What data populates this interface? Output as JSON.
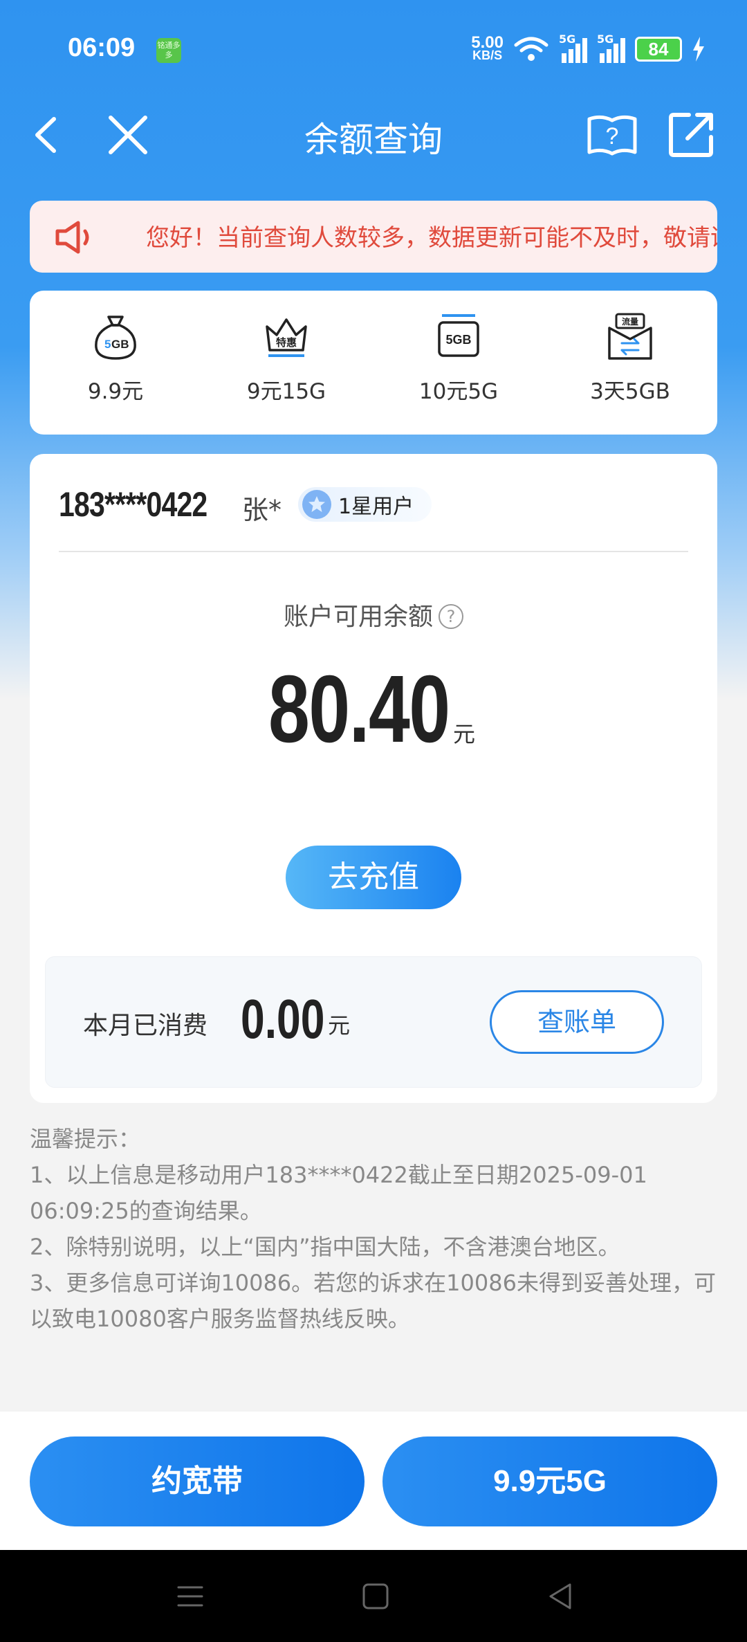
{
  "status_bar": {
    "time": "06:09",
    "app_icon_text": "铭通多多",
    "net_speed_value": "5.00",
    "net_speed_unit": "KB/S",
    "signal_1": "5G",
    "signal_2": "5G",
    "battery": "84"
  },
  "header": {
    "title": "余额查询"
  },
  "notice": {
    "text": "您好！当前查询人数较多，数据更新可能不及时，敬请谅解"
  },
  "packages": [
    {
      "icon": "5gb-bag-icon",
      "label": "9.9元"
    },
    {
      "icon": "special-offer-crown-icon",
      "label": "9元15G"
    },
    {
      "icon": "5gb-card-icon",
      "label": "10元5G"
    },
    {
      "icon": "data-flow-icon",
      "label": "3天5GB"
    }
  ],
  "account": {
    "phone": "183****0422",
    "name": "张*",
    "level": "1星用户",
    "balance_label": "账户可用余额",
    "help_symbol": "?",
    "balance": "80.40",
    "balance_unit": "元",
    "recharge_label": "去充值",
    "month_spend_label": "本月已消费",
    "month_spend": "0.00",
    "month_spend_unit": "元",
    "bill_label": "查账单"
  },
  "tips": {
    "title": "温馨提示：",
    "line1": "1、以上信息是移动用户183****0422截止至日期2025-09-01 06:09:25的查询结果。",
    "line2": "2、除特别说明，以上“国内”指中国大陆，不含港澳台地区。",
    "line3": "3、更多信息可详询10086。若您的诉求在10086未得到妥善处理，可以致电10080客户服务监督热线反映。"
  },
  "bottom_buttons": {
    "broadband": "约宽带",
    "promo": "9.9元5G"
  },
  "colors": {
    "brand_blue": "#2f93f0",
    "notice_red": "#e04a3c",
    "notice_bg": "#fdeeee"
  }
}
